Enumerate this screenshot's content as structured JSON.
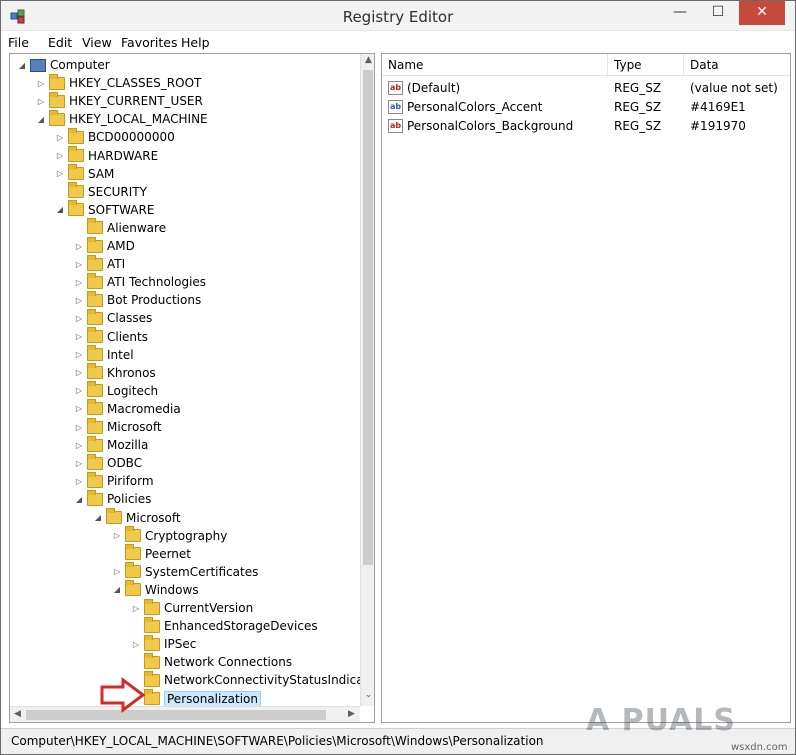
{
  "window": {
    "title": "Registry Editor",
    "close_glyph": "✕",
    "minimize_glyph": "—",
    "maximize_glyph": "☐"
  },
  "menu": [
    "File",
    "Edit",
    "View",
    "Favorites",
    "Help"
  ],
  "tree": [
    {
      "label": "Computer",
      "icon": "computer-icon",
      "expander": "◢",
      "depth": 0
    },
    {
      "label": "HKEY_CLASSES_ROOT",
      "icon": "folder-icon",
      "expander": "▷",
      "depth": 1
    },
    {
      "label": "HKEY_CURRENT_USER",
      "icon": "folder-icon",
      "expander": "▷",
      "depth": 1
    },
    {
      "label": "HKEY_LOCAL_MACHINE",
      "icon": "folder-icon",
      "expander": "◢",
      "depth": 1
    },
    {
      "label": "BCD00000000",
      "icon": "folder-icon",
      "expander": "▷",
      "depth": 2
    },
    {
      "label": "HARDWARE",
      "icon": "folder-icon",
      "expander": "▷",
      "depth": 2
    },
    {
      "label": "SAM",
      "icon": "folder-icon",
      "expander": "▷",
      "depth": 2
    },
    {
      "label": "SECURITY",
      "icon": "folder-icon",
      "expander": "",
      "depth": 2
    },
    {
      "label": "SOFTWARE",
      "icon": "folder-icon",
      "expander": "◢",
      "depth": 2
    },
    {
      "label": "Alienware",
      "icon": "folder-icon",
      "expander": "",
      "depth": 3
    },
    {
      "label": "AMD",
      "icon": "folder-icon",
      "expander": "▷",
      "depth": 3
    },
    {
      "label": "ATI",
      "icon": "folder-icon",
      "expander": "▷",
      "depth": 3
    },
    {
      "label": "ATI Technologies",
      "icon": "folder-icon",
      "expander": "▷",
      "depth": 3
    },
    {
      "label": "Bot Productions",
      "icon": "folder-icon",
      "expander": "▷",
      "depth": 3
    },
    {
      "label": "Classes",
      "icon": "folder-icon",
      "expander": "▷",
      "depth": 3
    },
    {
      "label": "Clients",
      "icon": "folder-icon",
      "expander": "▷",
      "depth": 3
    },
    {
      "label": "Intel",
      "icon": "folder-icon",
      "expander": "▷",
      "depth": 3
    },
    {
      "label": "Khronos",
      "icon": "folder-icon",
      "expander": "▷",
      "depth": 3
    },
    {
      "label": "Logitech",
      "icon": "folder-icon",
      "expander": "▷",
      "depth": 3
    },
    {
      "label": "Macromedia",
      "icon": "folder-icon",
      "expander": "▷",
      "depth": 3
    },
    {
      "label": "Microsoft",
      "icon": "folder-icon",
      "expander": "▷",
      "depth": 3
    },
    {
      "label": "Mozilla",
      "icon": "folder-icon",
      "expander": "▷",
      "depth": 3
    },
    {
      "label": "ODBC",
      "icon": "folder-icon",
      "expander": "▷",
      "depth": 3
    },
    {
      "label": "Piriform",
      "icon": "folder-icon",
      "expander": "▷",
      "depth": 3
    },
    {
      "label": "Policies",
      "icon": "folder-icon",
      "expander": "◢",
      "depth": 3
    },
    {
      "label": "Microsoft",
      "icon": "folder-icon",
      "expander": "◢",
      "depth": 4
    },
    {
      "label": "Cryptography",
      "icon": "folder-icon",
      "expander": "▷",
      "depth": 5
    },
    {
      "label": "Peernet",
      "icon": "folder-icon",
      "expander": "",
      "depth": 5
    },
    {
      "label": "SystemCertificates",
      "icon": "folder-icon",
      "expander": "▷",
      "depth": 5
    },
    {
      "label": "Windows",
      "icon": "folder-icon",
      "expander": "◢",
      "depth": 5
    },
    {
      "label": "CurrentVersion",
      "icon": "folder-icon",
      "expander": "▷",
      "depth": 6
    },
    {
      "label": "EnhancedStorageDevices",
      "icon": "folder-icon",
      "expander": "",
      "depth": 6
    },
    {
      "label": "IPSec",
      "icon": "folder-icon",
      "expander": "▷",
      "depth": 6
    },
    {
      "label": "Network Connections",
      "icon": "folder-icon",
      "expander": "",
      "depth": 6
    },
    {
      "label": "NetworkConnectivityStatusIndicator",
      "icon": "folder-icon",
      "expander": "",
      "depth": 6
    },
    {
      "label": "Personalization",
      "icon": "folder-icon",
      "expander": "",
      "depth": 6,
      "selected": true
    }
  ],
  "columns": {
    "name": "Name",
    "type": "Type",
    "data": "Data"
  },
  "values": [
    {
      "name": "(Default)",
      "type": "REG_SZ",
      "data": "(value not set)"
    },
    {
      "name": "PersonalColors_Accent",
      "type": "REG_SZ",
      "data": "#4169E1"
    },
    {
      "name": "PersonalColors_Background",
      "type": "REG_SZ",
      "data": "#191970"
    }
  ],
  "status": {
    "path": "Computer\\HKEY_LOCAL_MACHINE\\SOFTWARE\\Policies\\Microsoft\\Windows\\Personalization"
  },
  "scroll": {
    "up": "▲",
    "down": "⌄",
    "left": "◀",
    "right": "▶"
  },
  "watermark": {
    "brand": "A PUALS",
    "site": "wsxdn.com"
  },
  "colors": {
    "close_button": "#c74b3c",
    "selection": "#cce8ff",
    "folder": "#f0c84a",
    "arrow": "#d42a2a"
  }
}
